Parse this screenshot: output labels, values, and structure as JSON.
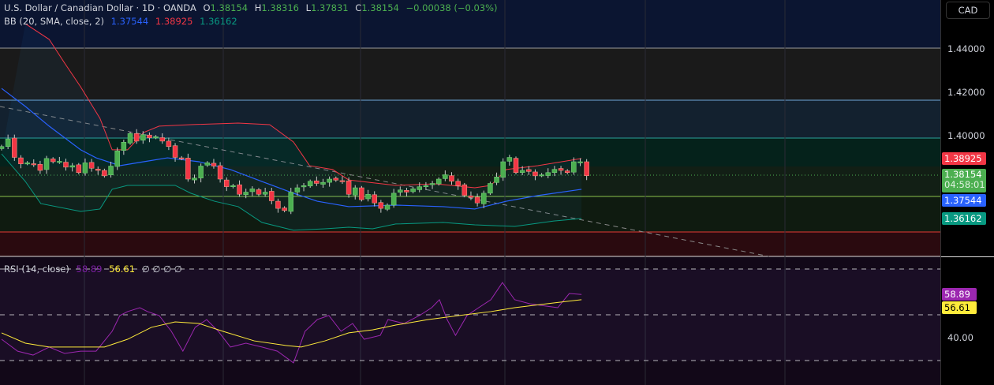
{
  "header": {
    "symbol": "U.S. Dollar / Canadian Dollar · 1D · OANDA",
    "o_label": "O",
    "o": "1.38154",
    "h_label": "H",
    "h": "1.38316",
    "l_label": "L",
    "l": "1.37831",
    "c_label": "C",
    "c": "1.38154",
    "change": "−0.00038 (−0.03%)"
  },
  "bb": {
    "label": "BB (20, SMA, close, 2)",
    "basis": "1.37544",
    "upper": "1.38925",
    "lower": "1.36162"
  },
  "rsi": {
    "label": "RSI (14, close)",
    "value": "58.89",
    "ma": "56.61",
    "extra": "∅ ∅ ∅ ∅"
  },
  "axis": {
    "currency": "CAD",
    "ticks": [
      "1.44000",
      "1.42000",
      "1.40000"
    ],
    "rsi_tick": "40.00",
    "tags": {
      "upper": "1.38925",
      "price": "1.38154",
      "countdown": "04:58:01",
      "basis": "1.37544",
      "lower": "1.36162",
      "rsi": "58.89",
      "rsi_ma": "56.61"
    }
  },
  "colors": {
    "up": "#4caf50",
    "down": "#f23645",
    "basis": "#2962ff",
    "upper": "#f23645",
    "lower": "#089981",
    "rsi": "#9c27b0",
    "rsi_ma": "#ffeb3b"
  },
  "chart_data": {
    "type": "candlestick",
    "price_range": [
      1.342,
      1.4625
    ],
    "closes": [
      1.395,
      1.3985,
      1.39,
      1.387,
      1.3875,
      1.3868,
      1.384,
      1.3895,
      1.388,
      1.3882,
      1.3855,
      1.3862,
      1.383,
      1.3875,
      1.385,
      1.384,
      1.3815,
      1.386,
      1.393,
      1.397,
      1.401,
      1.3975,
      1.4005,
      1.399,
      1.3995,
      1.3975,
      1.395,
      1.39,
      1.3895,
      1.38,
      1.3805,
      1.386,
      1.3875,
      1.386,
      1.38,
      1.3765,
      1.377,
      1.373,
      1.374,
      1.3755,
      1.373,
      1.374,
      1.37,
      1.3665,
      1.3655,
      1.374,
      1.376,
      1.377,
      1.379,
      1.378,
      1.3785,
      1.38,
      1.3795,
      1.379,
      1.373,
      1.376,
      1.3705,
      1.373,
      1.369,
      1.3665,
      1.368,
      1.3735,
      1.375,
      1.374,
      1.3755,
      1.3765,
      1.377,
      1.378,
      1.38,
      1.382,
      1.379,
      1.377,
      1.3725,
      1.3715,
      1.369,
      1.3735,
      1.378,
      1.381,
      1.388,
      1.39,
      1.383,
      1.384,
      1.3835,
      1.3815,
      1.382,
      1.383,
      1.3845,
      1.384,
      1.383,
      1.388,
      1.388,
      1.38154
    ],
    "bb_upper": [
      [
        3.7,
        1.4516
      ],
      [
        7.4,
        1.4444
      ],
      [
        9.8,
        1.4335
      ],
      [
        12.3,
        1.4225
      ],
      [
        15.3,
        1.408
      ],
      [
        17.2,
        1.3935
      ],
      [
        19.6,
        1.3935
      ],
      [
        22.1,
        1.4015
      ],
      [
        24.5,
        1.4044
      ],
      [
        29.4,
        1.4051
      ],
      [
        36.8,
        1.4058
      ],
      [
        41.7,
        1.4051
      ],
      [
        45.4,
        1.3971
      ],
      [
        47.9,
        1.3862
      ],
      [
        51.5,
        1.3844
      ],
      [
        54,
        1.3796
      ],
      [
        61.3,
        1.3771
      ],
      [
        67.5,
        1.3778
      ],
      [
        73.6,
        1.376
      ],
      [
        76.1,
        1.3771
      ],
      [
        78.5,
        1.3844
      ],
      [
        83.4,
        1.3862
      ],
      [
        90.2,
        1.3895
      ]
    ],
    "bb_basis": [
      [
        0,
        1.4218
      ],
      [
        3.7,
        1.4135
      ],
      [
        7.4,
        1.4044
      ],
      [
        12.3,
        1.3935
      ],
      [
        14.7,
        1.3898
      ],
      [
        18.4,
        1.3862
      ],
      [
        22.1,
        1.388
      ],
      [
        25.8,
        1.3898
      ],
      [
        30.7,
        1.388
      ],
      [
        35.6,
        1.3844
      ],
      [
        40.5,
        1.3789
      ],
      [
        45.4,
        1.3735
      ],
      [
        49.1,
        1.3698
      ],
      [
        54,
        1.3673
      ],
      [
        61.3,
        1.368
      ],
      [
        68.7,
        1.3673
      ],
      [
        73.6,
        1.3662
      ],
      [
        78.5,
        1.3698
      ],
      [
        83.4,
        1.3724
      ],
      [
        90.2,
        1.3753
      ]
    ],
    "bb_lower": [
      [
        0,
        1.3916
      ],
      [
        3.7,
        1.3789
      ],
      [
        6.1,
        1.3687
      ],
      [
        12.3,
        1.3651
      ],
      [
        15.3,
        1.3662
      ],
      [
        17.2,
        1.3753
      ],
      [
        19.6,
        1.3771
      ],
      [
        27,
        1.3771
      ],
      [
        29.4,
        1.3735
      ],
      [
        33.1,
        1.3698
      ],
      [
        36.8,
        1.3673
      ],
      [
        40.5,
        1.36
      ],
      [
        45.4,
        1.3564
      ],
      [
        50.3,
        1.3571
      ],
      [
        54,
        1.3578
      ],
      [
        57.7,
        1.3571
      ],
      [
        61.3,
        1.3593
      ],
      [
        68.7,
        1.36
      ],
      [
        73.6,
        1.3589
      ],
      [
        79.8,
        1.3582
      ],
      [
        85.9,
        1.3607
      ],
      [
        90.2,
        1.3618
      ]
    ],
    "rsi_range": [
      24,
      80
    ],
    "rsi_levels": [
      70,
      50,
      30
    ],
    "rsi_line": [
      [
        0,
        39.3
      ],
      [
        2.5,
        34.1
      ],
      [
        4.9,
        32.4
      ],
      [
        7.4,
        35.9
      ],
      [
        9.8,
        33.1
      ],
      [
        12.3,
        34.1
      ],
      [
        14.7,
        34.1
      ],
      [
        17.2,
        42.8
      ],
      [
        18.4,
        49.7
      ],
      [
        19.6,
        51.4
      ],
      [
        21.5,
        53.1
      ],
      [
        22.7,
        51.4
      ],
      [
        24.5,
        49.7
      ],
      [
        26.4,
        42.8
      ],
      [
        28.2,
        34.1
      ],
      [
        30.1,
        44.5
      ],
      [
        31.9,
        47.9
      ],
      [
        33.7,
        42.8
      ],
      [
        35.6,
        35.9
      ],
      [
        38,
        37.6
      ],
      [
        40.5,
        35.9
      ],
      [
        42.9,
        34.1
      ],
      [
        45.4,
        29.0
      ],
      [
        47.2,
        42.8
      ],
      [
        49.1,
        47.9
      ],
      [
        50.9,
        49.7
      ],
      [
        52.8,
        42.8
      ],
      [
        54.6,
        46.2
      ],
      [
        56.4,
        39.3
      ],
      [
        58.9,
        41.0
      ],
      [
        60.1,
        47.9
      ],
      [
        62.6,
        46.2
      ],
      [
        65,
        49.7
      ],
      [
        66.9,
        53.1
      ],
      [
        68.1,
        56.6
      ],
      [
        69.3,
        47.9
      ],
      [
        70.6,
        41.0
      ],
      [
        72.4,
        49.7
      ],
      [
        74.2,
        53.1
      ],
      [
        76.1,
        56.6
      ],
      [
        77.9,
        64.1
      ],
      [
        79.8,
        56.6
      ],
      [
        82.2,
        54.8
      ],
      [
        84.7,
        53.8
      ],
      [
        86.5,
        53.1
      ],
      [
        88.3,
        59.3
      ],
      [
        90.2,
        58.89
      ]
    ],
    "rsi_ma": [
      [
        0,
        42.1
      ],
      [
        3.7,
        37.6
      ],
      [
        7.4,
        35.9
      ],
      [
        12.3,
        35.9
      ],
      [
        16,
        35.9
      ],
      [
        19.6,
        39.3
      ],
      [
        23.3,
        44.5
      ],
      [
        27,
        46.9
      ],
      [
        30.7,
        46.2
      ],
      [
        34.4,
        42.8
      ],
      [
        39.3,
        38.6
      ],
      [
        44.2,
        36.6
      ],
      [
        46.6,
        35.9
      ],
      [
        50.3,
        38.6
      ],
      [
        54,
        42.1
      ],
      [
        57.7,
        43.4
      ],
      [
        61.3,
        45.5
      ],
      [
        66.3,
        47.9
      ],
      [
        71.2,
        49.7
      ],
      [
        76.1,
        51.4
      ],
      [
        79.8,
        53.1
      ],
      [
        84.7,
        54.8
      ],
      [
        90.2,
        56.61
      ]
    ]
  }
}
